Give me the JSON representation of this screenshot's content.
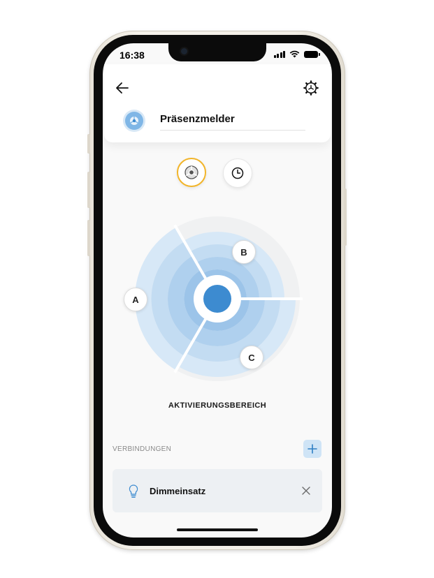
{
  "status_bar": {
    "time": "16:38"
  },
  "header": {
    "device_name": "Präsenzmelder",
    "back_icon": "arrow-left-icon",
    "settings_icon": "gear-icon"
  },
  "mode_toggle": {
    "active": "sensor",
    "sensor_icon": "motion-sensor-icon",
    "clock_icon": "clock-icon"
  },
  "zones": {
    "labels": [
      "A",
      "B",
      "C"
    ],
    "center_color": "#3d8bd0",
    "ring_colors": [
      "#d7e8f7",
      "#c3dcf2",
      "#afd0ee",
      "#9cc4e9"
    ],
    "caption": "AKTIVIERUNGSBEREICH"
  },
  "connections": {
    "caption": "VERBINDUNGEN",
    "items": [
      {
        "name": "Dimmeinsatz",
        "icon": "lightbulb-icon"
      }
    ]
  },
  "accent": "#f2b52a"
}
